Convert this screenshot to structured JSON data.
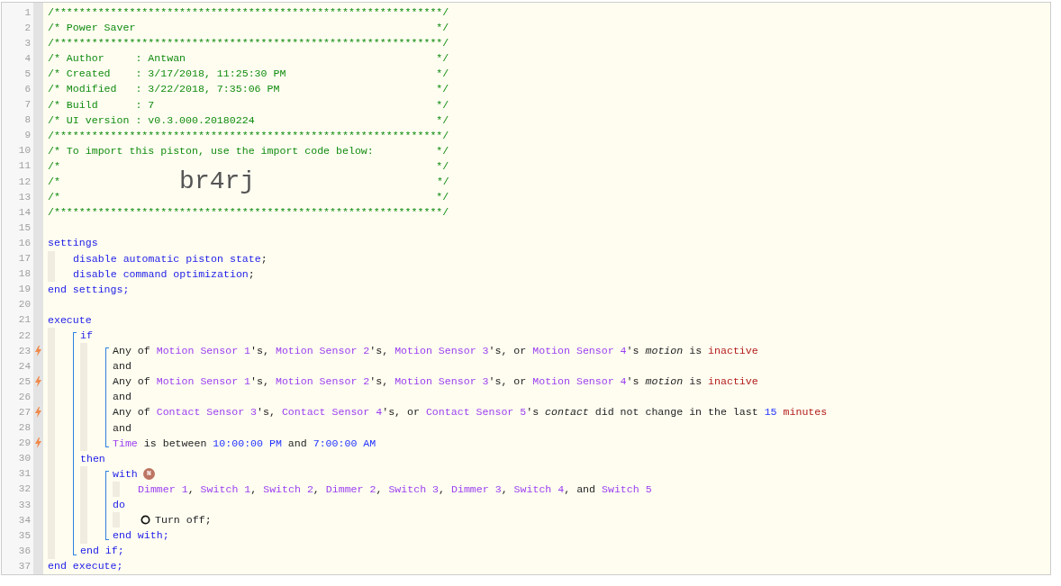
{
  "lines": [
    {
      "kind": "line",
      "number": "1",
      "trigger": false,
      "segments": [
        {
          "kind": "comment",
          "text": "/**************************************************************/"
        }
      ]
    },
    {
      "kind": "line",
      "number": "2",
      "trigger": false,
      "segments": [
        {
          "kind": "comment",
          "text": "/* Power Saver                                                */"
        }
      ]
    },
    {
      "kind": "line",
      "number": "3",
      "trigger": false,
      "segments": [
        {
          "kind": "comment",
          "text": "/**************************************************************/"
        }
      ]
    },
    {
      "kind": "line",
      "number": "4",
      "trigger": false,
      "segments": [
        {
          "kind": "comment",
          "text": "/* Author     : Antwan                                        */"
        }
      ]
    },
    {
      "kind": "line",
      "number": "5",
      "trigger": false,
      "segments": [
        {
          "kind": "comment",
          "text": "/* Created    : 3/17/2018, 11:25:30 PM                        */"
        }
      ]
    },
    {
      "kind": "line",
      "number": "6",
      "trigger": false,
      "segments": [
        {
          "kind": "comment",
          "text": "/* Modified   : 3/22/2018, 7:35:06 PM                         */"
        }
      ]
    },
    {
      "kind": "line",
      "number": "7",
      "trigger": false,
      "segments": [
        {
          "kind": "comment",
          "text": "/* Build      : 7                                             */"
        }
      ]
    },
    {
      "kind": "line",
      "number": "8",
      "trigger": false,
      "segments": [
        {
          "kind": "comment",
          "text": "/* UI version : v0.3.000.20180224                             */"
        }
      ]
    },
    {
      "kind": "line",
      "number": "9",
      "trigger": false,
      "segments": [
        {
          "kind": "comment",
          "text": "/**************************************************************/"
        }
      ]
    },
    {
      "kind": "line",
      "number": "10",
      "trigger": false,
      "segments": [
        {
          "kind": "comment",
          "text": "/* To import this piston, use the import code below:          */"
        }
      ]
    },
    {
      "kind": "line",
      "number": "11",
      "trigger": false,
      "segments": [
        {
          "kind": "comment",
          "text": "/*                                                            */"
        }
      ]
    },
    {
      "kind": "line",
      "number": "12",
      "trigger": false,
      "segments": [
        {
          "kind": "comment",
          "text": "/*                   "
        },
        {
          "kind": "big-code",
          "text": "br4rj"
        },
        {
          "kind": "comment",
          "text": "                             */"
        }
      ]
    },
    {
      "kind": "line",
      "number": "13",
      "trigger": false,
      "segments": [
        {
          "kind": "comment",
          "text": "/*                                                            */"
        }
      ]
    },
    {
      "kind": "line",
      "number": "14",
      "trigger": false,
      "segments": [
        {
          "kind": "comment",
          "text": "/**************************************************************/"
        }
      ]
    },
    {
      "kind": "line",
      "number": "15",
      "trigger": false
    },
    {
      "kind": "line",
      "number": "16",
      "trigger": false,
      "segments": [
        {
          "kind": "keyword",
          "text": "settings"
        }
      ],
      "children": [
        {
          "kind": "line",
          "number": "17",
          "trigger": false,
          "segments": [
            {
              "kind": "keyword",
              "text": "disable automatic piston state"
            },
            {
              "kind": "plain",
              "text": ";"
            }
          ]
        },
        {
          "kind": "line",
          "number": "18",
          "trigger": false,
          "segments": [
            {
              "kind": "keyword",
              "text": "disable command optimization"
            },
            {
              "kind": "plain",
              "text": ";"
            }
          ]
        }
      ]
    },
    {
      "kind": "line",
      "number": "19",
      "trigger": false,
      "segments": [
        {
          "kind": "keyword",
          "text": "end settings;"
        }
      ]
    },
    {
      "kind": "line",
      "number": "20",
      "trigger": false
    },
    {
      "kind": "line",
      "number": "21",
      "trigger": false,
      "segments": [
        {
          "kind": "keyword",
          "text": "execute"
        }
      ],
      "children": [
        {
          "kind": "group",
          "items": [
            {
              "kind": "line",
              "number": "22",
              "trigger": false,
              "segments": [
                {
                  "kind": "keyword",
                  "text": "if"
                }
              ],
              "children": [
                {
                  "kind": "group",
                  "items": [
                    {
                      "kind": "line",
                      "number": "23",
                      "trigger": true,
                      "segments": [
                        {
                          "kind": "plain",
                          "text": "Any of "
                        },
                        {
                          "kind": "device",
                          "text": "Motion Sensor 1"
                        },
                        {
                          "kind": "plain",
                          "text": "'s, "
                        },
                        {
                          "kind": "device",
                          "text": "Motion Sensor 2"
                        },
                        {
                          "kind": "plain",
                          "text": "'s, "
                        },
                        {
                          "kind": "device",
                          "text": "Motion Sensor 3"
                        },
                        {
                          "kind": "plain",
                          "text": "'s, or "
                        },
                        {
                          "kind": "device",
                          "text": "Motion Sensor 4"
                        },
                        {
                          "kind": "plain",
                          "text": "'s "
                        },
                        {
                          "kind": "attribute",
                          "text": "motion"
                        },
                        {
                          "kind": "plain",
                          "text": " is "
                        },
                        {
                          "kind": "value",
                          "text": "inactive"
                        }
                      ]
                    },
                    {
                      "kind": "line",
                      "number": "24",
                      "trigger": false,
                      "segments": [
                        {
                          "kind": "plain",
                          "text": "and"
                        }
                      ]
                    },
                    {
                      "kind": "line",
                      "number": "25",
                      "trigger": true,
                      "segments": [
                        {
                          "kind": "plain",
                          "text": "Any of "
                        },
                        {
                          "kind": "device",
                          "text": "Motion Sensor 1"
                        },
                        {
                          "kind": "plain",
                          "text": "'s, "
                        },
                        {
                          "kind": "device",
                          "text": "Motion Sensor 2"
                        },
                        {
                          "kind": "plain",
                          "text": "'s, "
                        },
                        {
                          "kind": "device",
                          "text": "Motion Sensor 3"
                        },
                        {
                          "kind": "plain",
                          "text": "'s, or "
                        },
                        {
                          "kind": "device",
                          "text": "Motion Sensor 4"
                        },
                        {
                          "kind": "plain",
                          "text": "'s "
                        },
                        {
                          "kind": "attribute",
                          "text": "motion"
                        },
                        {
                          "kind": "plain",
                          "text": " is "
                        },
                        {
                          "kind": "value",
                          "text": "inactive"
                        }
                      ]
                    },
                    {
                      "kind": "line",
                      "number": "26",
                      "trigger": false,
                      "segments": [
                        {
                          "kind": "plain",
                          "text": "and"
                        }
                      ]
                    },
                    {
                      "kind": "line",
                      "number": "27",
                      "trigger": true,
                      "segments": [
                        {
                          "kind": "plain",
                          "text": "Any of "
                        },
                        {
                          "kind": "device",
                          "text": "Contact Sensor 3"
                        },
                        {
                          "kind": "plain",
                          "text": "'s, "
                        },
                        {
                          "kind": "device",
                          "text": "Contact Sensor 4"
                        },
                        {
                          "kind": "plain",
                          "text": "'s, or "
                        },
                        {
                          "kind": "device",
                          "text": "Contact Sensor 5"
                        },
                        {
                          "kind": "plain",
                          "text": "'s "
                        },
                        {
                          "kind": "attribute",
                          "text": "contact"
                        },
                        {
                          "kind": "plain",
                          "text": " did not change in the last "
                        },
                        {
                          "kind": "literal",
                          "text": "15"
                        },
                        {
                          "kind": "value",
                          "text": " minutes"
                        }
                      ]
                    },
                    {
                      "kind": "line",
                      "number": "28",
                      "trigger": false,
                      "segments": [
                        {
                          "kind": "plain",
                          "text": "and"
                        }
                      ]
                    },
                    {
                      "kind": "line",
                      "number": "29",
                      "trigger": true,
                      "segments": [
                        {
                          "kind": "device",
                          "text": "Time"
                        },
                        {
                          "kind": "plain",
                          "text": " is between "
                        },
                        {
                          "kind": "literal",
                          "text": "10:00:00 PM"
                        },
                        {
                          "kind": "plain",
                          "text": " and "
                        },
                        {
                          "kind": "literal",
                          "text": "7:00:00 AM"
                        }
                      ]
                    }
                  ]
                }
              ]
            },
            {
              "kind": "line",
              "number": "30",
              "trigger": false,
              "segments": [
                {
                  "kind": "keyword",
                  "text": "then"
                }
              ],
              "children": [
                {
                  "kind": "group",
                  "items": [
                    {
                      "kind": "line",
                      "number": "31",
                      "trigger": false,
                      "segments": [
                        {
                          "kind": "keyword",
                          "text": "with"
                        },
                        {
                          "kind": "badge",
                          "text": "N"
                        }
                      ],
                      "children": [
                        {
                          "kind": "line",
                          "number": "32",
                          "trigger": false,
                          "segments": [
                            {
                              "kind": "device",
                              "text": "Dimmer 1"
                            },
                            {
                              "kind": "plain",
                              "text": ", "
                            },
                            {
                              "kind": "device",
                              "text": "Switch 1"
                            },
                            {
                              "kind": "plain",
                              "text": ", "
                            },
                            {
                              "kind": "device",
                              "text": "Switch 2"
                            },
                            {
                              "kind": "plain",
                              "text": ", "
                            },
                            {
                              "kind": "device",
                              "text": "Dimmer 2"
                            },
                            {
                              "kind": "plain",
                              "text": ", "
                            },
                            {
                              "kind": "device",
                              "text": "Switch 3"
                            },
                            {
                              "kind": "plain",
                              "text": ", "
                            },
                            {
                              "kind": "device",
                              "text": "Dimmer 3"
                            },
                            {
                              "kind": "plain",
                              "text": ", "
                            },
                            {
                              "kind": "device",
                              "text": "Switch 4"
                            },
                            {
                              "kind": "plain",
                              "text": ", and "
                            },
                            {
                              "kind": "device",
                              "text": "Switch 5"
                            }
                          ]
                        }
                      ]
                    },
                    {
                      "kind": "line",
                      "number": "33",
                      "trigger": false,
                      "segments": [
                        {
                          "kind": "keyword",
                          "text": "do"
                        }
                      ],
                      "children": [
                        {
                          "kind": "line",
                          "number": "34",
                          "trigger": false,
                          "segments": [
                            {
                              "kind": "task-icon"
                            },
                            {
                              "kind": "plain",
                              "text": "Turn off;"
                            }
                          ]
                        }
                      ]
                    },
                    {
                      "kind": "line",
                      "number": "35",
                      "trigger": false,
                      "segments": [
                        {
                          "kind": "keyword",
                          "text": "end with;"
                        }
                      ]
                    }
                  ]
                }
              ]
            },
            {
              "kind": "line",
              "number": "36",
              "trigger": false,
              "segments": [
                {
                  "kind": "keyword",
                  "text": "end if;"
                }
              ]
            }
          ]
        }
      ]
    },
    {
      "kind": "line",
      "number": "37",
      "trigger": false,
      "segments": [
        {
          "kind": "keyword",
          "text": "end execute;"
        }
      ]
    }
  ]
}
